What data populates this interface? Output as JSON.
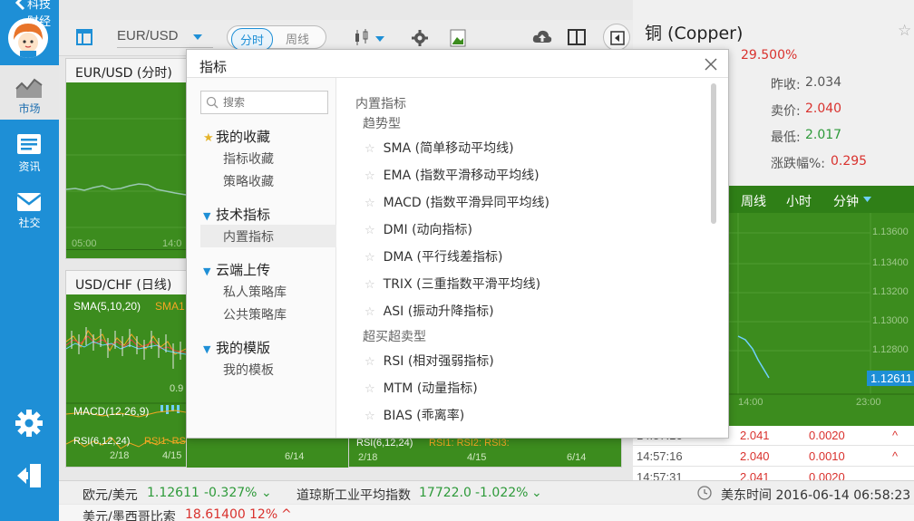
{
  "app": {
    "title": "科技财经"
  },
  "sidebar": {
    "items": [
      {
        "label": "市场",
        "icon": "chart-icon"
      },
      {
        "label": "资讯",
        "icon": "news-icon"
      },
      {
        "label": "社交",
        "icon": "mail-icon"
      }
    ]
  },
  "toolbar": {
    "pair": "EUR/USD",
    "mode_active": "分时",
    "mode_inactive": "周线"
  },
  "panels": {
    "top_left": {
      "title": "EUR/USD (分时)",
      "time_left": "05:00",
      "time_right": "14:0"
    },
    "mid_left": {
      "title": "USD/CHF (日线)",
      "ma_label": "SMA(5,10,20)",
      "ma_label2": "SMA1",
      "macd_label": "MACD(12,26,9)",
      "rsi_label": "RSI(6,12,24)",
      "rsi_tags": "RSI1: RSI2: RSI3:",
      "dates": [
        "2/18",
        "4/15",
        "6/14"
      ],
      "value": "0.9"
    },
    "mid_right": {
      "rsi_label": "RSI(6,12,24)",
      "rsi_tags": "RSI1: RSI2: RSI3:",
      "dates": [
        "2/18",
        "4/15",
        "6/14"
      ]
    }
  },
  "right_panel": {
    "title": "铜 (Copper)",
    "change_pct": "29.500%",
    "rows": [
      {
        "label": "昨收:",
        "value": "2.034",
        "color": "#555555"
      },
      {
        "label": "卖价:",
        "value": "2.040",
        "color": "#d9322e"
      },
      {
        "label": "最低:",
        "value": "2.017",
        "color": "#2e9a3a"
      },
      {
        "label": "涨跌幅%:",
        "value": "0.295",
        "color": "#d9322e"
      }
    ],
    "tabs": [
      "周线",
      "小时",
      "分钟"
    ],
    "price_ticks": [
      "1.13600",
      "1.13400",
      "1.13200",
      "1.13000",
      "1.12800"
    ],
    "current_price": "1.12611",
    "time_ticks": [
      "14:00",
      "23:00"
    ],
    "trades": [
      {
        "time": "14:57:16",
        "price": "2.041",
        "change": "0.0020"
      },
      {
        "time": "14:57:16",
        "price": "2.040",
        "change": "0.0010"
      },
      {
        "time": "14:57:31",
        "price": "2.041",
        "change": "0.0020"
      }
    ]
  },
  "status_bar": {
    "quote1_name": "欧元/美元",
    "quote1_price": "1.12611",
    "quote1_change": "-0.327%",
    "quote2_name": "道琼斯工业平均指数",
    "quote2_price": "17722.0",
    "quote2_change": "-1.022%",
    "clock": "美东时间 2016-06-14 06:58:23",
    "quote3_name": "美元/墨西哥比索",
    "quote3_price": "18.61400",
    "quote3_change": "12%"
  },
  "dialog": {
    "title": "指标",
    "search_placeholder": "搜索",
    "nav": [
      {
        "group": "我的收藏",
        "items": [
          "指标收藏",
          "策略收藏"
        ]
      },
      {
        "group": "技术指标",
        "items": [
          "内置指标"
        ]
      },
      {
        "group": "云端上传",
        "items": [
          "私人策略库",
          "公共策略库"
        ]
      },
      {
        "group": "我的模版",
        "items": [
          "我的模板"
        ]
      }
    ],
    "section_title": "内置指标",
    "trend_title": "趋势型",
    "trend": [
      "SMA (简单移动平均线)",
      "EMA (指数平滑移动平均线)",
      "MACD (指数平滑异同平均线)",
      "DMI (动向指标)",
      "DMA (平行线差指标)",
      "TRIX (三重指数平滑平均线)",
      "ASI (振动升降指标)"
    ],
    "osc_title": "超买超卖型",
    "osc": [
      "RSI (相对强弱指标)",
      "MTM (动量指标)",
      "BIAS (乖离率)"
    ]
  }
}
